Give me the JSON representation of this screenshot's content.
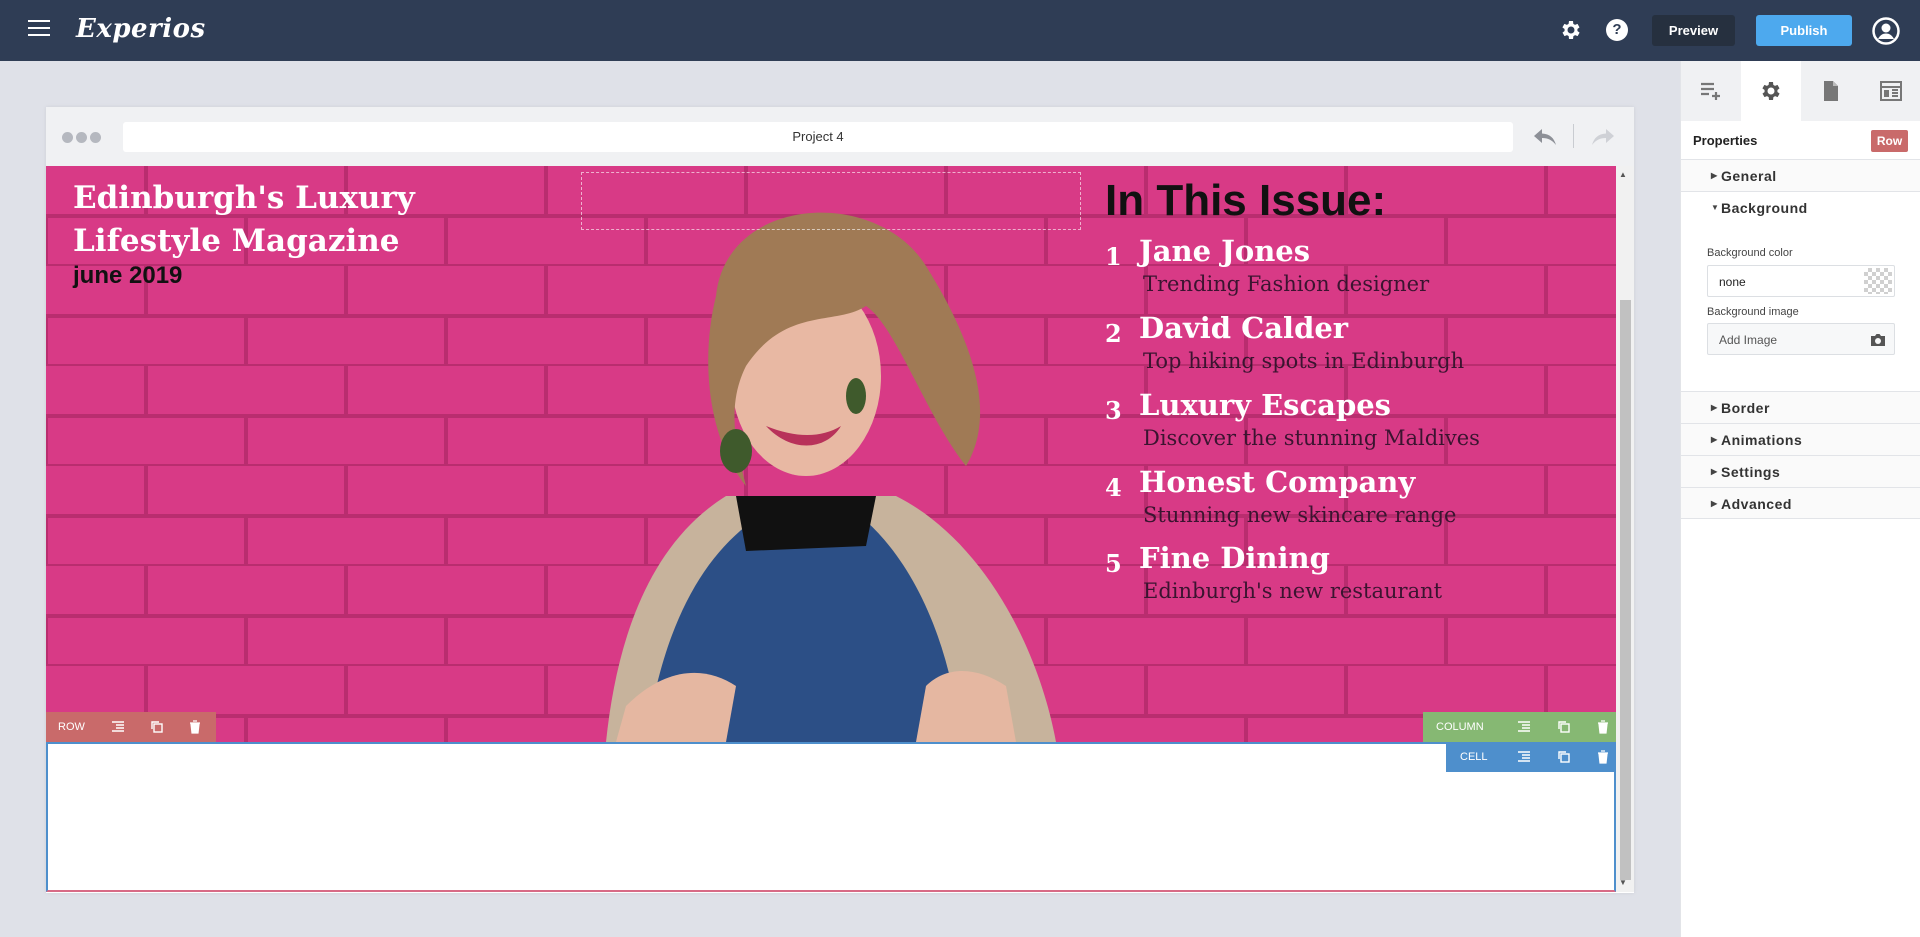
{
  "app": {
    "logo": "Experios"
  },
  "header": {
    "preview_label": "Preview",
    "publish_label": "Publish",
    "help_glyph": "?"
  },
  "canvas": {
    "url": "Project 4"
  },
  "hero": {
    "title": "Edinburgh's Luxury Lifestyle Magazine",
    "date": "june 2019",
    "issue_title": "In This Issue:",
    "items": [
      {
        "num": "1",
        "title": "Jane Jones",
        "subtitle": "Trending Fashion designer"
      },
      {
        "num": "2",
        "title": "David Calder",
        "subtitle": "Top hiking spots in Edinburgh"
      },
      {
        "num": "3",
        "title": "Luxury Escapes",
        "subtitle": "Discover the stunning Maldives"
      },
      {
        "num": "4",
        "title": "Honest Company",
        "subtitle": "Stunning new skincare range"
      },
      {
        "num": "5",
        "title": "Fine Dining",
        "subtitle": "Edinburgh's new restaurant"
      }
    ]
  },
  "toolbars": {
    "row": "ROW",
    "column": "COLUMN",
    "cell": "CELL"
  },
  "panel": {
    "title": "Properties",
    "badge": "Row",
    "sections": {
      "general": "General",
      "background": "Background",
      "border": "Border",
      "animations": "Animations",
      "settings": "Settings",
      "advanced": "Advanced"
    },
    "background_color_label": "Background color",
    "background_color_value": "none",
    "background_image_label": "Background image",
    "background_image_placeholder": "Add Image"
  },
  "colors": {
    "topbar": "#2f3d55",
    "publish": "#4da9ee",
    "row": "#c96a6a",
    "column": "#86b873",
    "cell": "#4e8fcc",
    "hero": "#d83a86"
  }
}
